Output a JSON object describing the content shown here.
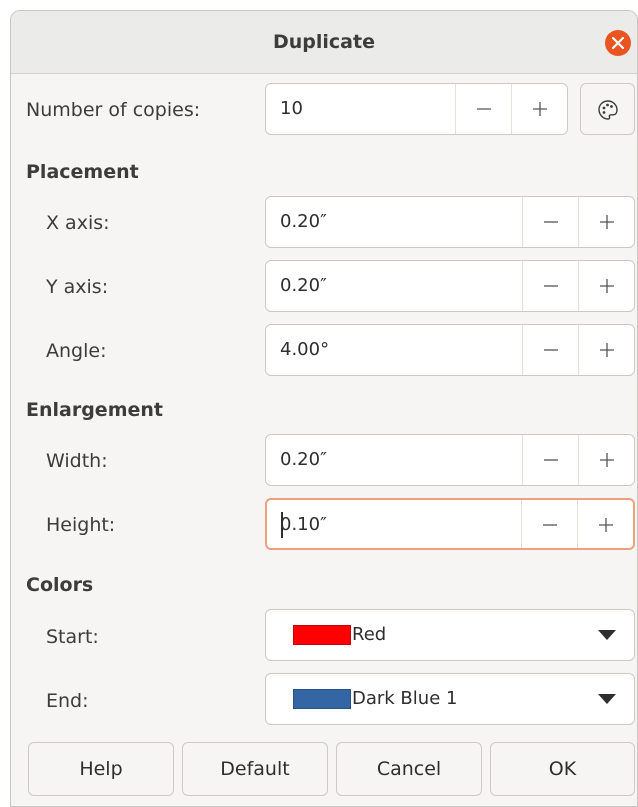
{
  "window": {
    "title": "Duplicate"
  },
  "copies": {
    "label": "Number of copies:",
    "value": "10"
  },
  "placement": {
    "heading": "Placement",
    "x_label": "X axis:",
    "x_value": "0.20″",
    "y_label": "Y axis:",
    "y_value": "0.20″",
    "angle_label": "Angle:",
    "angle_value": "4.00°"
  },
  "enlargement": {
    "heading": "Enlargement",
    "width_label": "Width:",
    "width_value": "0.20″",
    "height_label": "Height:",
    "height_value": "0.10″"
  },
  "colors": {
    "heading": "Colors",
    "start_label": "Start:",
    "start_value": "Red",
    "start_color": "#ff0000",
    "end_label": "End:",
    "end_value": "Dark Blue 1",
    "end_color": "#3465a4"
  },
  "buttons": {
    "help": "Help",
    "default": "Default",
    "cancel": "Cancel",
    "ok": "OK"
  },
  "icons": {
    "close": "close-icon",
    "color_picker": "color-palette-icon",
    "minus": "minus-icon",
    "plus": "plus-icon",
    "dropdown": "chevron-down-icon"
  },
  "accent_color": "#e95420"
}
